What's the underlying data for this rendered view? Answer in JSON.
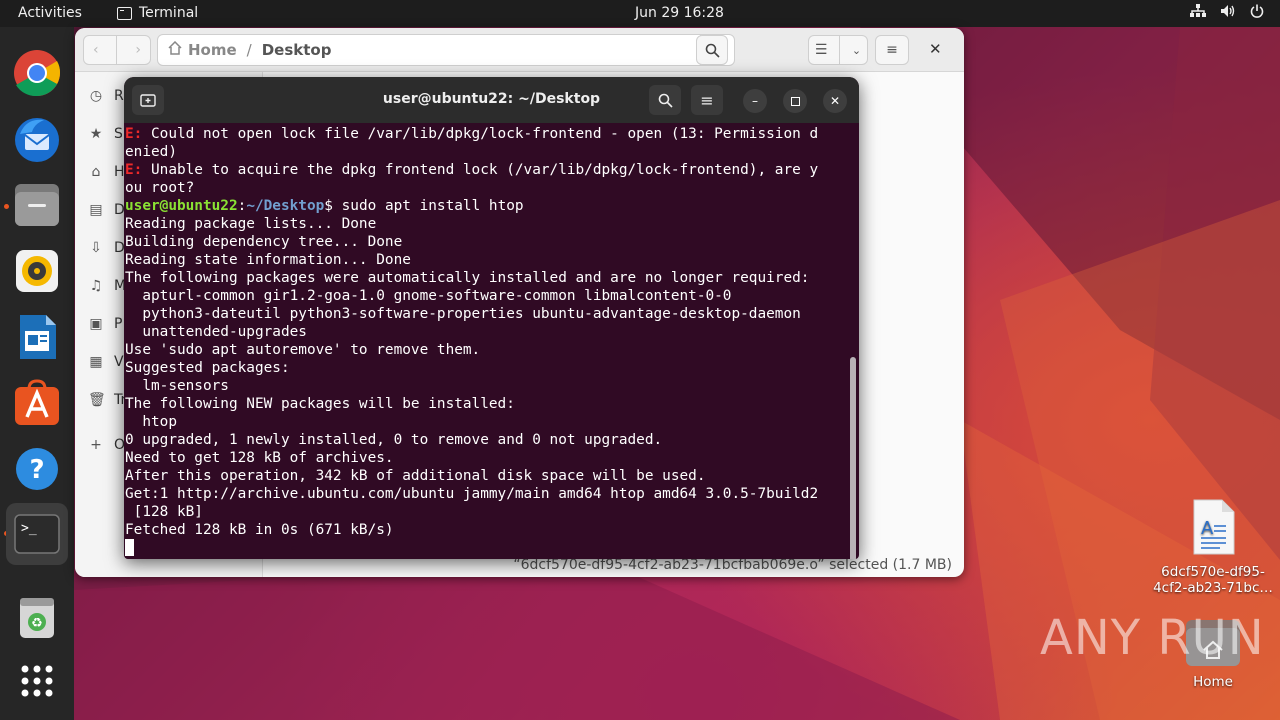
{
  "topbar": {
    "activities": "Activities",
    "app_name": "Terminal",
    "clock": "Jun 29  16:28",
    "tray_icons": [
      "network-icon",
      "volume-icon",
      "power-icon"
    ]
  },
  "dock": {
    "items": [
      "chrome-icon",
      "thunderbird-icon",
      "files-icon",
      "rhythmbox-icon",
      "libreoffice-writer-icon",
      "app-center-icon",
      "help-icon",
      "terminal-icon",
      "trash-icon",
      "show-apps-icon"
    ]
  },
  "files": {
    "breadcrumb_home": "Home",
    "breadcrumb_sep": "/",
    "breadcrumb_current": "Desktop",
    "sidebar": [
      {
        "icon": "recent-icon",
        "label": "R"
      },
      {
        "icon": "star-icon",
        "label": "S"
      },
      {
        "icon": "home-icon",
        "label": "H"
      },
      {
        "icon": "document-icon",
        "label": "D"
      },
      {
        "icon": "download-icon",
        "label": "D"
      },
      {
        "icon": "music-icon",
        "label": "M"
      },
      {
        "icon": "picture-icon",
        "label": "P"
      },
      {
        "icon": "video-icon",
        "label": "V"
      },
      {
        "icon": "trash-icon",
        "label": "Tr"
      },
      {
        "icon": "plus-icon",
        "label": "O"
      }
    ],
    "status": "“6dcf570e-df95-4cf2-ab23-71bcfbab069e.o” selected  (1.7 MB)"
  },
  "terminal": {
    "title": "user@ubuntu22: ~/Desktop",
    "lines": {
      "l1_err": "E:",
      "l1": " Could not open lock file /var/lib/dpkg/lock-frontend - open (13: Permission d",
      "l2": "enied)",
      "l3_err": "E:",
      "l3": " Unable to acquire the dpkg frontend lock (/var/lib/dpkg/lock-frontend), are y",
      "l4": "ou root?",
      "prompt_user": "user@ubuntu22",
      "prompt_colon": ":",
      "prompt_path": "~/Desktop",
      "prompt_cmd": "$ sudo apt install htop",
      "l6": "Reading package lists... Done",
      "l7": "Building dependency tree... Done",
      "l8": "Reading state information... Done",
      "l9": "The following packages were automatically installed and are no longer required:",
      "l10": "  apturl-common gir1.2-goa-1.0 gnome-software-common libmalcontent-0-0",
      "l11": "  python3-dateutil python3-software-properties ubuntu-advantage-desktop-daemon",
      "l12": "  unattended-upgrades",
      "l13": "Use 'sudo apt autoremove' to remove them.",
      "l14": "Suggested packages:",
      "l15": "  lm-sensors",
      "l16": "The following NEW packages will be installed:",
      "l17": "  htop",
      "l18": "0 upgraded, 1 newly installed, 0 to remove and 0 not upgraded.",
      "l19": "Need to get 128 kB of archives.",
      "l20": "After this operation, 342 kB of additional disk space will be used.",
      "l21": "Get:1 http://archive.ubuntu.com/ubuntu jammy/main amd64 htop amd64 3.0.5-7build2",
      "l22": " [128 kB]",
      "l23": "Fetched 128 kB in 0s (671 kB/s)"
    }
  },
  "desktop": {
    "file_label_1": "6dcf570e-df95-",
    "file_label_2": "4cf2-ab23-71bc…",
    "home_label": "Home",
    "watermark": "ANY RUN"
  }
}
